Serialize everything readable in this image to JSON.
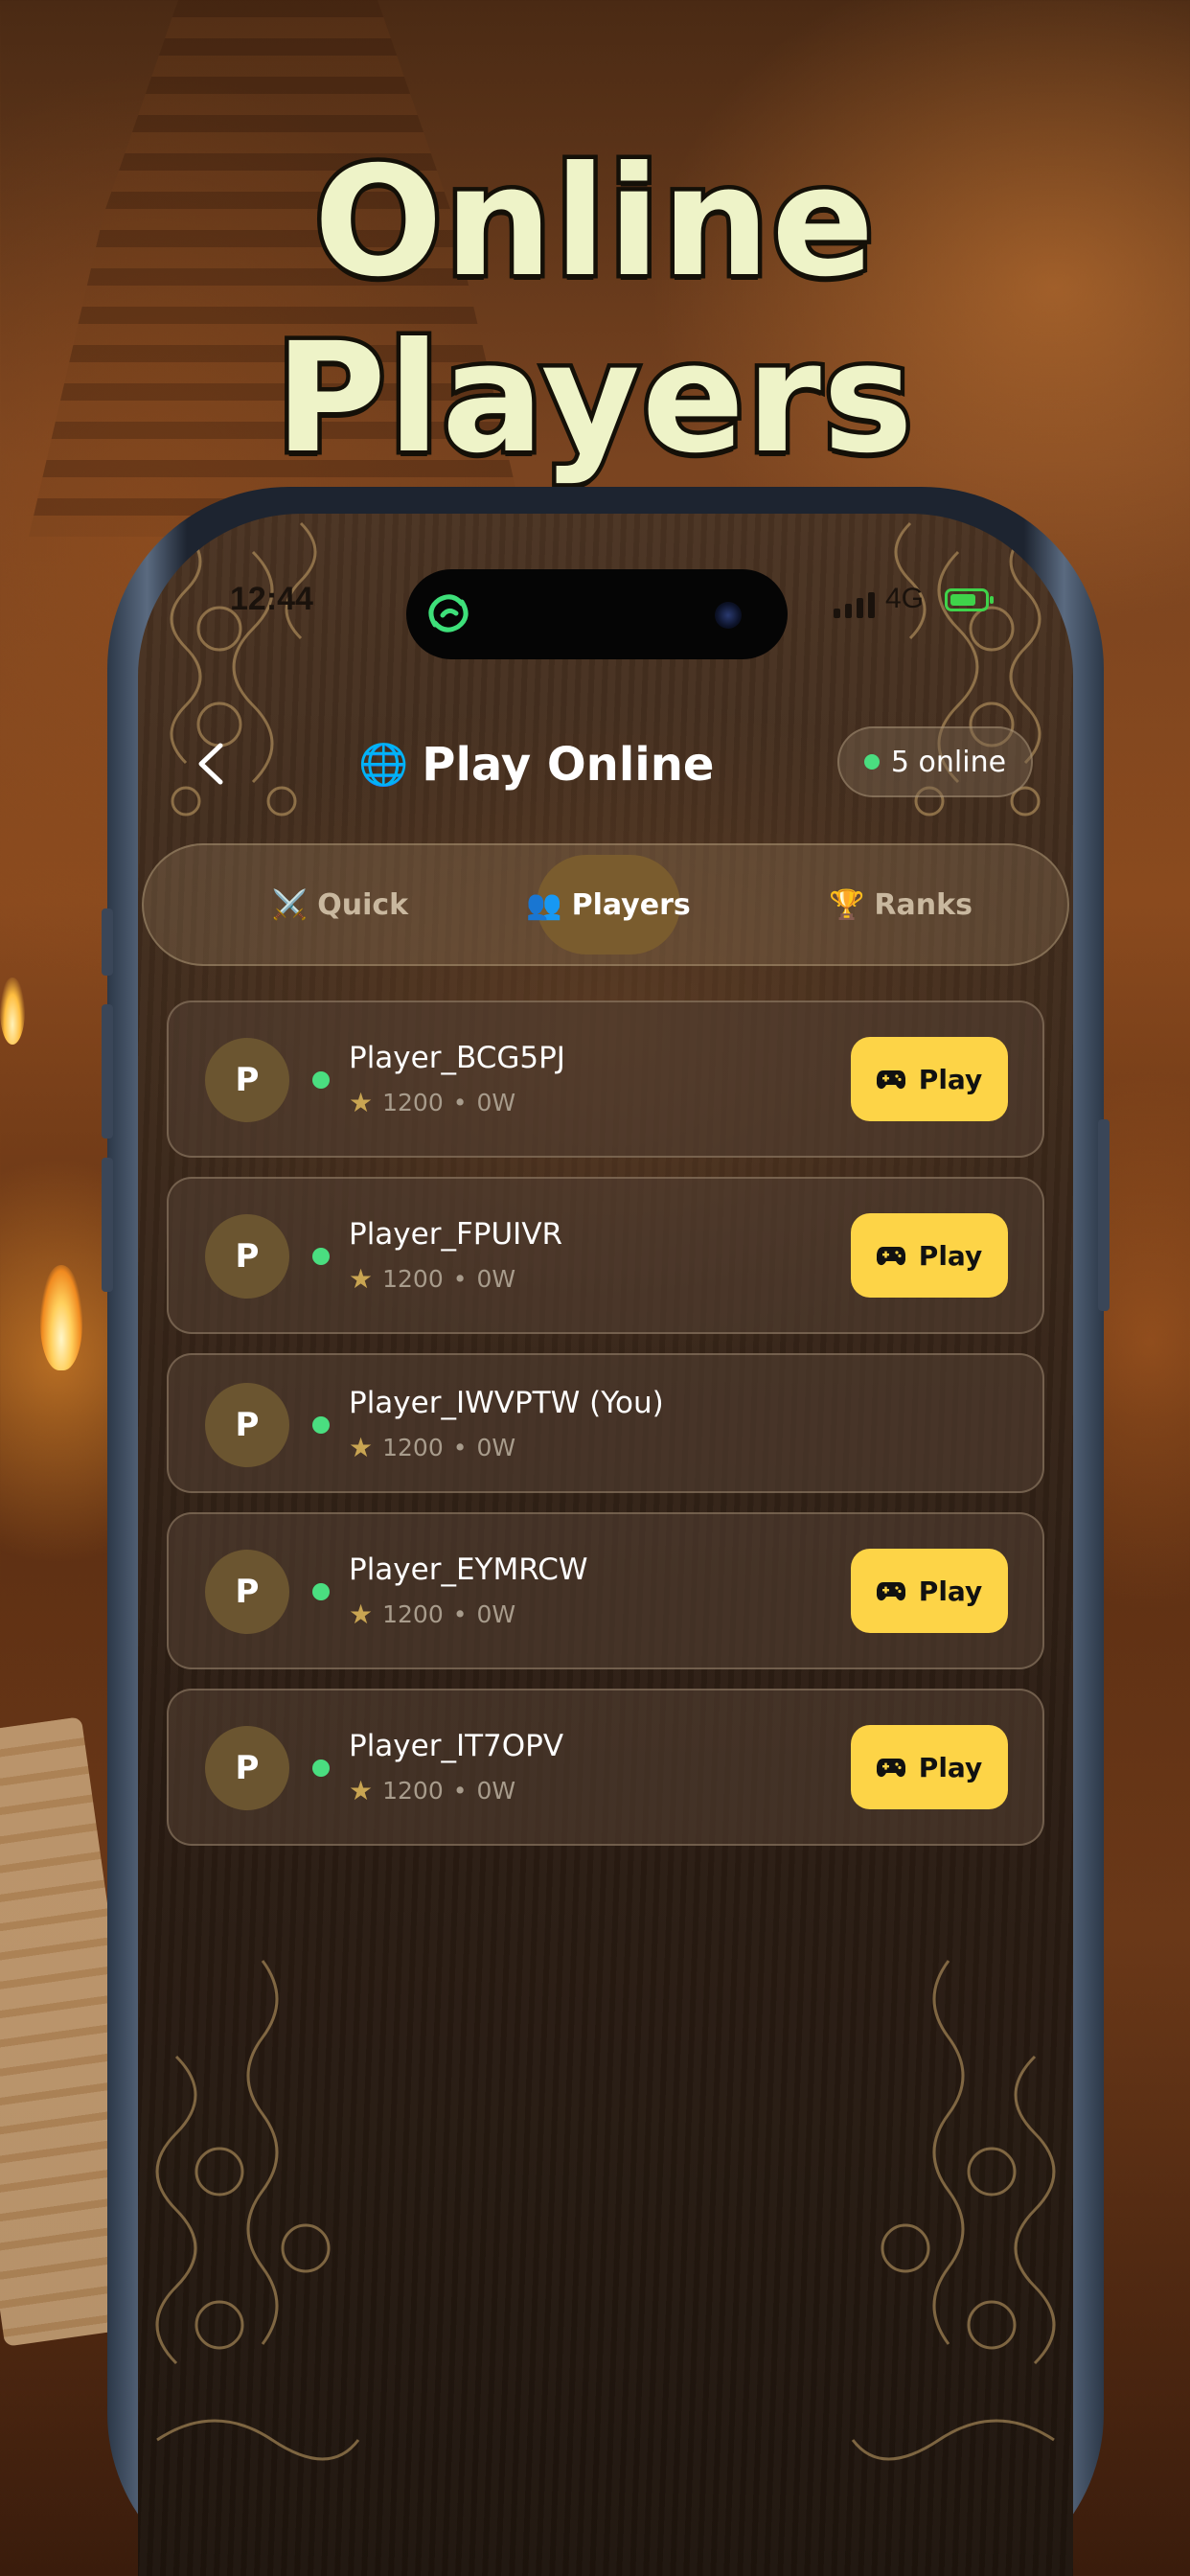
{
  "headline": "Online Players",
  "status_bar": {
    "time": "12:44",
    "network": "4G"
  },
  "header": {
    "back_icon": "chevron-left-icon",
    "globe_icon": "🌐",
    "title": "Play Online",
    "online_count_label": "5 online"
  },
  "tabs": [
    {
      "icon": "⚔️",
      "label": "Quick",
      "active": false
    },
    {
      "icon": "👥",
      "label": "Players",
      "active": true
    },
    {
      "icon": "🏆",
      "label": "Ranks",
      "active": false
    }
  ],
  "players": [
    {
      "initial": "P",
      "name": "Player_BCG5PJ",
      "rating": "1200",
      "separator": "•",
      "wins": "0W",
      "play_label": "Play",
      "show_play": true
    },
    {
      "initial": "P",
      "name": "Player_FPUIVR",
      "rating": "1200",
      "separator": "•",
      "wins": "0W",
      "play_label": "Play",
      "show_play": true
    },
    {
      "initial": "P",
      "name": "Player_IWVPTW (You)",
      "rating": "1200",
      "separator": "•",
      "wins": "0W",
      "play_label": "",
      "show_play": false
    },
    {
      "initial": "P",
      "name": "Player_EYMRCW",
      "rating": "1200",
      "separator": "•",
      "wins": "0W",
      "play_label": "Play",
      "show_play": true
    },
    {
      "initial": "P",
      "name": "Player_IT7OPV",
      "rating": "1200",
      "separator": "•",
      "wins": "0W",
      "play_label": "Play",
      "show_play": true
    }
  ],
  "colors": {
    "accent_play": "#fdd447",
    "online_dot": "#4ade80",
    "headline_fill": "#eef3c8",
    "avatar": "#6b5530"
  }
}
